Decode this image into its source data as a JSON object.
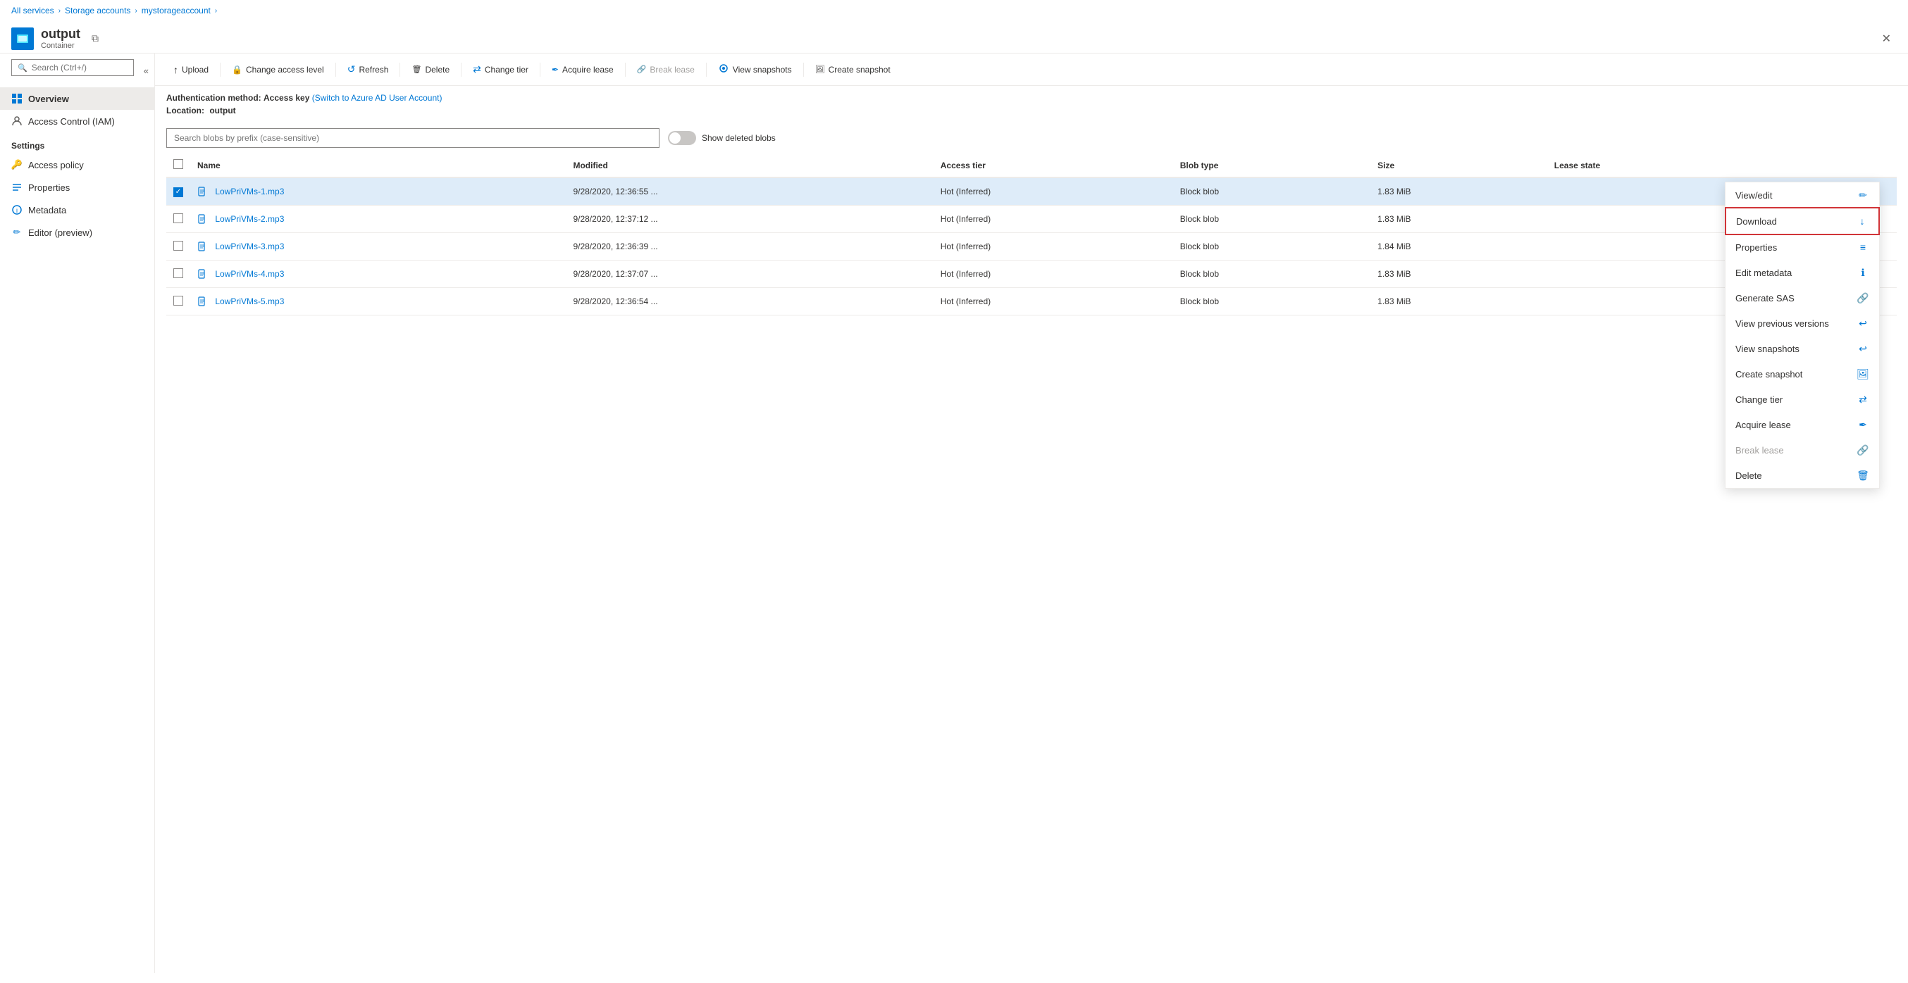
{
  "breadcrumb": {
    "items": [
      "All services",
      "Storage accounts",
      "mystorageaccount"
    ],
    "separators": [
      ">",
      ">",
      ">"
    ]
  },
  "header": {
    "icon_label": "O",
    "title": "output",
    "subtitle": "Container",
    "close_label": "✕"
  },
  "sidebar": {
    "search_placeholder": "Search (Ctrl+/)",
    "collapse_label": "«",
    "nav_items": [
      {
        "id": "overview",
        "label": "Overview",
        "active": true,
        "icon": "overview"
      },
      {
        "id": "iam",
        "label": "Access Control (IAM)",
        "active": false,
        "icon": "iam"
      }
    ],
    "settings_label": "Settings",
    "settings_items": [
      {
        "id": "access-policy",
        "label": "Access policy",
        "icon": "policy"
      },
      {
        "id": "properties",
        "label": "Properties",
        "icon": "properties"
      },
      {
        "id": "metadata",
        "label": "Metadata",
        "icon": "metadata"
      },
      {
        "id": "editor",
        "label": "Editor (preview)",
        "icon": "editor"
      }
    ]
  },
  "toolbar": {
    "buttons": [
      {
        "id": "upload",
        "label": "Upload",
        "icon": "↑",
        "disabled": false
      },
      {
        "id": "change-access",
        "label": "Change access level",
        "icon": "🔒",
        "disabled": false
      },
      {
        "id": "refresh",
        "label": "Refresh",
        "icon": "↺",
        "disabled": false
      },
      {
        "id": "delete",
        "label": "Delete",
        "icon": "🗑",
        "disabled": false
      },
      {
        "id": "change-tier",
        "label": "Change tier",
        "icon": "⇄",
        "disabled": false
      },
      {
        "id": "acquire-lease",
        "label": "Acquire lease",
        "icon": "✒",
        "disabled": false
      },
      {
        "id": "break-lease",
        "label": "Break lease",
        "icon": "🔗",
        "disabled": true
      },
      {
        "id": "view-snapshots",
        "label": "View snapshots",
        "icon": "📷",
        "disabled": false
      },
      {
        "id": "create-snapshot",
        "label": "Create snapshot",
        "icon": "🖼",
        "disabled": false
      }
    ]
  },
  "auth": {
    "label": "Authentication method:",
    "value": "Access key",
    "link_text": "(Switch to Azure AD User Account)",
    "location_label": "Location:",
    "location_value": "output"
  },
  "search": {
    "placeholder": "Search blobs by prefix (case-sensitive)",
    "show_deleted_label": "Show deleted blobs"
  },
  "table": {
    "columns": [
      "Name",
      "Modified",
      "Access tier",
      "Blob type",
      "Size",
      "Lease state"
    ],
    "rows": [
      {
        "id": 1,
        "name": "LowPriVMs-1.mp3",
        "modified": "9/28/2020, 12:36:55 ...",
        "access_tier": "Hot (Inferred)",
        "blob_type": "Block blob",
        "size": "1.83 MiB",
        "lease_state": "",
        "selected": true
      },
      {
        "id": 2,
        "name": "LowPriVMs-2.mp3",
        "modified": "9/28/2020, 12:37:12 ...",
        "access_tier": "Hot (Inferred)",
        "blob_type": "Block blob",
        "size": "1.83 MiB",
        "lease_state": "",
        "selected": false
      },
      {
        "id": 3,
        "name": "LowPriVMs-3.mp3",
        "modified": "9/28/2020, 12:36:39 ...",
        "access_tier": "Hot (Inferred)",
        "blob_type": "Block blob",
        "size": "1.84 MiB",
        "lease_state": "",
        "selected": false
      },
      {
        "id": 4,
        "name": "LowPriVMs-4.mp3",
        "modified": "9/28/2020, 12:37:07 ...",
        "access_tier": "Hot (Inferred)",
        "blob_type": "Block blob",
        "size": "1.83 MiB",
        "lease_state": "",
        "selected": false
      },
      {
        "id": 5,
        "name": "LowPriVMs-5.mp3",
        "modified": "9/28/2020, 12:36:54 ...",
        "access_tier": "Hot (Inferred)",
        "blob_type": "Block blob",
        "size": "1.83 MiB",
        "lease_state": "",
        "selected": false
      }
    ]
  },
  "context_menu": {
    "visible": true,
    "items": [
      {
        "id": "view-edit",
        "label": "View/edit",
        "icon": "✏",
        "disabled": false,
        "highlighted": false
      },
      {
        "id": "download",
        "label": "Download",
        "icon": "↓",
        "disabled": false,
        "highlighted": true
      },
      {
        "id": "properties",
        "label": "Properties",
        "icon": "≡",
        "disabled": false,
        "highlighted": false
      },
      {
        "id": "edit-metadata",
        "label": "Edit metadata",
        "icon": "ℹ",
        "disabled": false,
        "highlighted": false
      },
      {
        "id": "generate-sas",
        "label": "Generate SAS",
        "icon": "🔗",
        "disabled": false,
        "highlighted": false
      },
      {
        "id": "view-previous-versions",
        "label": "View previous versions",
        "icon": "↩",
        "disabled": false,
        "highlighted": false
      },
      {
        "id": "view-snapshots",
        "label": "View snapshots",
        "icon": "↩",
        "disabled": false,
        "highlighted": false
      },
      {
        "id": "create-snapshot",
        "label": "Create snapshot",
        "icon": "🖼",
        "disabled": false,
        "highlighted": false
      },
      {
        "id": "change-tier",
        "label": "Change tier",
        "icon": "⇄",
        "disabled": false,
        "highlighted": false
      },
      {
        "id": "acquire-lease",
        "label": "Acquire lease",
        "icon": "✒",
        "disabled": false,
        "highlighted": false
      },
      {
        "id": "break-lease",
        "label": "Break lease",
        "icon": "🔗",
        "disabled": true,
        "highlighted": false
      },
      {
        "id": "delete",
        "label": "Delete",
        "icon": "🗑",
        "disabled": false,
        "highlighted": false
      }
    ]
  },
  "colors": {
    "accent": "#0078d4",
    "highlight_border": "#d13438",
    "selected_row": "#deecf9",
    "checked_bg": "#0078d4"
  }
}
